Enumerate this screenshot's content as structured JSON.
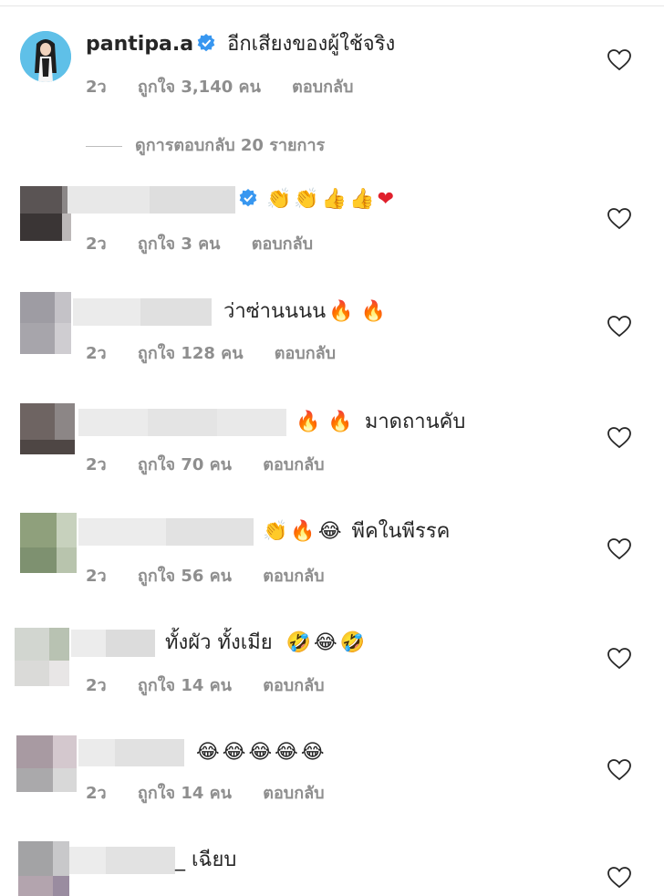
{
  "main_comment": {
    "username": "pantipa.a",
    "text": "อีกเสียงของผู้ใช้จริง",
    "time": "2ว",
    "likes": "ถูกใจ 3,140 คน",
    "reply": "ตอบกลับ"
  },
  "view_replies": "ดูการตอบกลับ 20 รายการ",
  "replies": [
    {
      "text": "",
      "time": "2ว",
      "likes": "ถูกใจ 3 คน",
      "reply": "ตอบกลับ",
      "emojis": [
        "clap-emoji",
        "clap-emoji",
        "thumbs-up-emoji",
        "thumbs-up-emoji",
        "red-heart-emoji"
      ]
    },
    {
      "text": "ว่าซ่านนนน",
      "time": "2ว",
      "likes": "ถูกใจ 128 คน",
      "reply": "ตอบกลับ",
      "emojis": [
        "fire-emoji",
        "fire-emoji"
      ]
    },
    {
      "text": "มาดถานคับ",
      "time": "2ว",
      "likes": "ถูกใจ 70 คน",
      "reply": "ตอบกลับ",
      "emojis": [
        "fire-emoji",
        "fire-emoji"
      ]
    },
    {
      "text": "พีคในพีรรค",
      "time": "2ว",
      "likes": "ถูกใจ 56 คน",
      "reply": "ตอบกลับ",
      "emojis": [
        "clap-emoji",
        "fire-emoji",
        "joy-emoji"
      ]
    },
    {
      "text": "ทั้งผัว ทั้งเมีย",
      "time": "2ว",
      "likes": "ถูกใจ 14 คน",
      "reply": "ตอบกลับ",
      "emojis": [
        "rofl-emoji",
        "joy-emoji",
        "rofl-emoji"
      ]
    },
    {
      "text": "",
      "time": "2ว",
      "likes": "ถูกใจ 14 คน",
      "reply": "ตอบกลับ",
      "emojis": [
        "joy-emoji",
        "joy-emoji",
        "joy-emoji",
        "joy-emoji",
        "joy-emoji"
      ]
    },
    {
      "text": "_ เฉียบ",
      "time": "",
      "likes": "",
      "reply": "",
      "emojis": []
    }
  ],
  "colors": {
    "verified": "#3897f0",
    "meta": "#8e8e8e",
    "avatar_bg": "#5fc0e8"
  }
}
